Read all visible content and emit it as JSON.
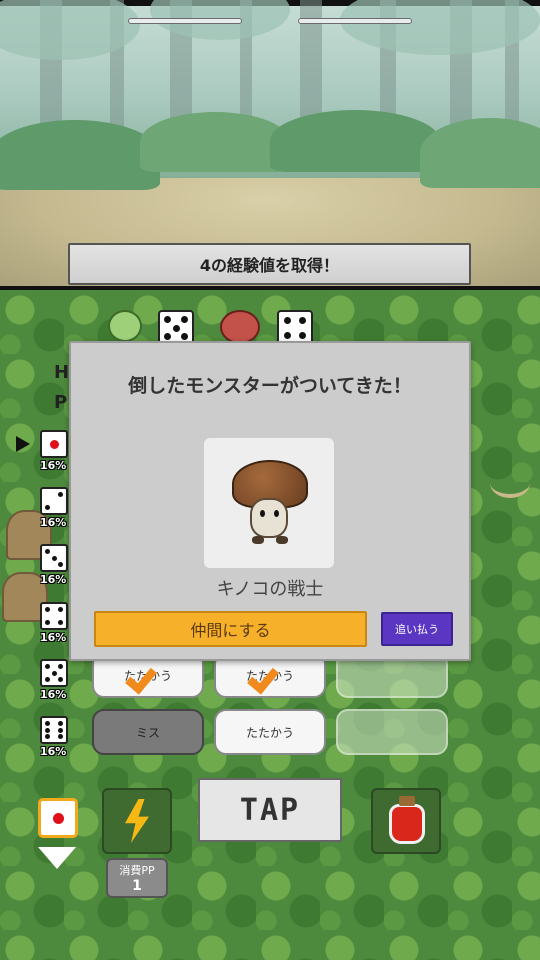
{
  "battle": {
    "message": "4の経験値を取得！"
  },
  "status_partial": {
    "line1": "H",
    "line2": "P"
  },
  "dice_probabilities": [
    {
      "face": 1,
      "percent": "16%"
    },
    {
      "face": 2,
      "percent": "16%"
    },
    {
      "face": 3,
      "percent": "16%"
    },
    {
      "face": 4,
      "percent": "16%"
    },
    {
      "face": 5,
      "percent": "16%"
    },
    {
      "face": 6,
      "percent": "16%"
    }
  ],
  "commands": {
    "row1": [
      "たたかう",
      "たたかう",
      ""
    ],
    "row2": [
      "ミス",
      "たたかう",
      ""
    ]
  },
  "actions": {
    "tap_label": "TAP",
    "pp_label": "消費PP",
    "pp_value": "1"
  },
  "dialog": {
    "title": "倒したモンスターがついてきた！",
    "monster_name": "キノコの戦士",
    "recruit_label": "仲間にする",
    "dismiss_label": "追い払う"
  },
  "colors": {
    "recruit": "#f7b02a",
    "dismiss": "#5a36c2",
    "check": "#f08a1c"
  },
  "icons": {
    "skill": "lightning-bolt-icon",
    "item": "potion-bottle-icon"
  }
}
